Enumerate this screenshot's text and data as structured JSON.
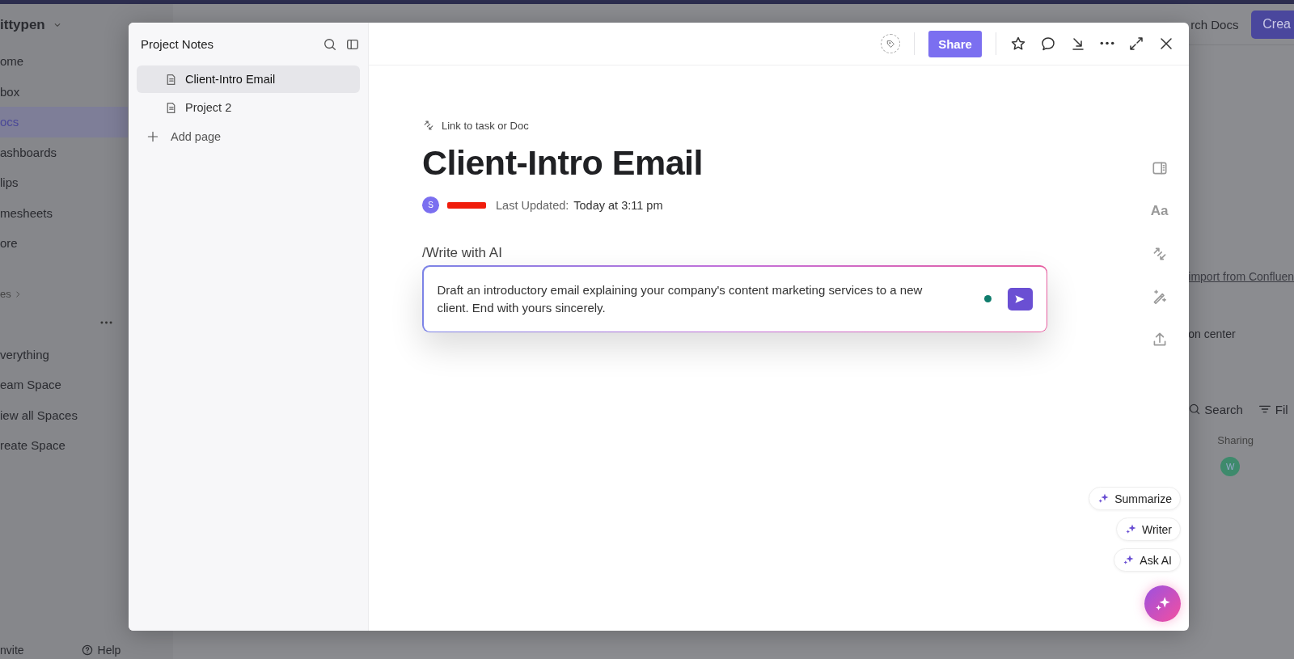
{
  "background": {
    "workspace": "ittypen",
    "nav": [
      {
        "label": "ome",
        "selected": false
      },
      {
        "label": "box",
        "selected": false
      },
      {
        "label": "ocs",
        "selected": true
      },
      {
        "label": "ashboards",
        "selected": false
      },
      {
        "label": "lips",
        "selected": false
      },
      {
        "label": "mesheets",
        "selected": false
      },
      {
        "label": "ore",
        "selected": false
      }
    ],
    "section": "es",
    "spaces": [
      "verything",
      "eam Space",
      "iew all Spaces",
      "reate Space"
    ],
    "footer": [
      "nvite",
      "Help"
    ],
    "top_search": "rch Docs",
    "create_button": "Crea",
    "import_link": "import from Confluen",
    "help_text": "on center",
    "search_button": "Search",
    "filter_button": "Fil",
    "column": "Sharing",
    "avatar": "W"
  },
  "sidebar": {
    "title": "Project Notes",
    "pages": [
      {
        "title": "Client-Intro Email",
        "selected": true
      },
      {
        "title": "Project 2",
        "selected": false
      }
    ],
    "add_page": "Add page"
  },
  "toolbar": {
    "share": "Share"
  },
  "doc": {
    "link": "Link to task or Doc",
    "title": "Client-Intro Email",
    "avatar": "S",
    "last_updated_label": "Last Updated:",
    "last_updated": "Today at 3:11 pm",
    "command": "/Write with AI",
    "prompt": "Draft an introductory email explaining your company's content marketing services to a new client. End with yours sincerely."
  },
  "tools": [
    {
      "kind": "panel"
    },
    {
      "kind": "text",
      "label": "Aa"
    },
    {
      "kind": "link"
    },
    {
      "kind": "magic"
    },
    {
      "kind": "export"
    }
  ],
  "ai_actions": [
    "Summarize",
    "Writer",
    "Ask AI"
  ]
}
